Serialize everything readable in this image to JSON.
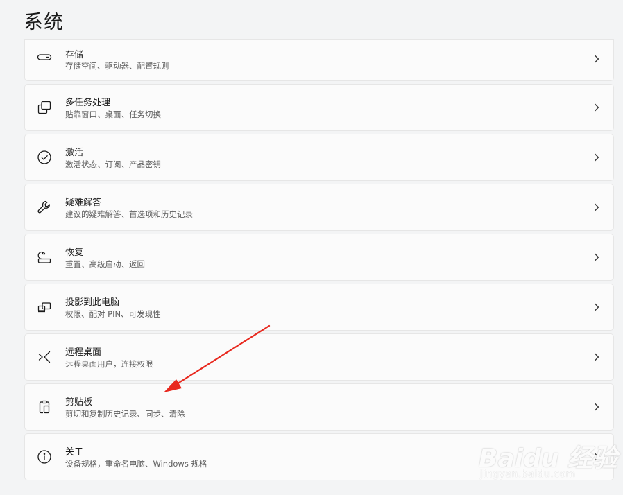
{
  "page": {
    "title": "系统"
  },
  "items": [
    {
      "id": "storage",
      "icon": "storage-icon",
      "title": "存储",
      "subtitle": "存储空间、驱动器、配置规则"
    },
    {
      "id": "multitasking",
      "icon": "multitasking-icon",
      "title": "多任务处理",
      "subtitle": "贴靠窗口、桌面、任务切换"
    },
    {
      "id": "activation",
      "icon": "check-circle-icon",
      "title": "激活",
      "subtitle": "激活状态、订阅、产品密钥"
    },
    {
      "id": "troubleshoot",
      "icon": "wrench-icon",
      "title": "疑难解答",
      "subtitle": "建议的疑难解答、首选项和历史记录"
    },
    {
      "id": "recovery",
      "icon": "recovery-icon",
      "title": "恢复",
      "subtitle": "重置、高级启动、返回"
    },
    {
      "id": "projecting",
      "icon": "projection-icon",
      "title": "投影到此电脑",
      "subtitle": "权限、配对 PIN、可发现性"
    },
    {
      "id": "remote-desktop",
      "icon": "remote-desktop-icon",
      "title": "远程桌面",
      "subtitle": "远程桌面用户，连接权限"
    },
    {
      "id": "clipboard",
      "icon": "clipboard-icon",
      "title": "剪贴板",
      "subtitle": "剪切和复制历史记录、同步、清除"
    },
    {
      "id": "about",
      "icon": "info-icon",
      "title": "关于",
      "subtitle": "设备规格，重命名电脑、Windows 规格"
    }
  ],
  "annotation": {
    "arrow_color": "#e8281e"
  },
  "watermark": {
    "logo": "Baidu 经验",
    "url": "jingyan.baidu.com"
  }
}
